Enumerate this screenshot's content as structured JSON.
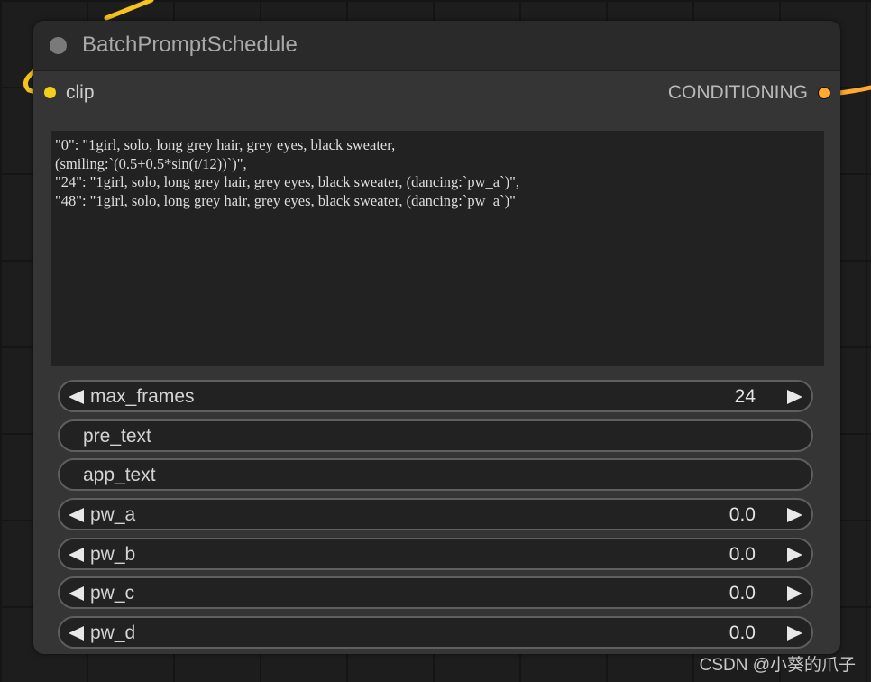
{
  "node": {
    "title": "BatchPromptSchedule",
    "input_label": "clip",
    "output_label": "CONDITIONING"
  },
  "prompt_lines": [
    "\"0\": \"1girl, solo, long grey hair, grey eyes, black sweater,",
    "(smiling:`(0.5+0.5*sin(t/12))`)\",",
    "\"24\": \"1girl, solo, long grey hair, grey eyes, black sweater, (dancing:`pw_a`)\",",
    "\"48\": \"1girl, solo, long grey hair, grey eyes, black sweater, (dancing:`pw_a`)\""
  ],
  "widgets": {
    "max_frames": {
      "label": "max_frames",
      "value": "24"
    },
    "pre_text": {
      "label": "pre_text"
    },
    "app_text": {
      "label": "app_text"
    },
    "pw_a": {
      "label": "pw_a",
      "value": "0.0"
    },
    "pw_b": {
      "label": "pw_b",
      "value": "0.0"
    },
    "pw_c": {
      "label": "pw_c",
      "value": "0.0"
    },
    "pw_d": {
      "label": "pw_d",
      "value": "0.0"
    }
  },
  "watermark": "CSDN @小葵的爪子",
  "colors": {
    "input_slot": "#f4cf17",
    "output_slot": "#ffa931",
    "wire": "#f7c21e"
  }
}
